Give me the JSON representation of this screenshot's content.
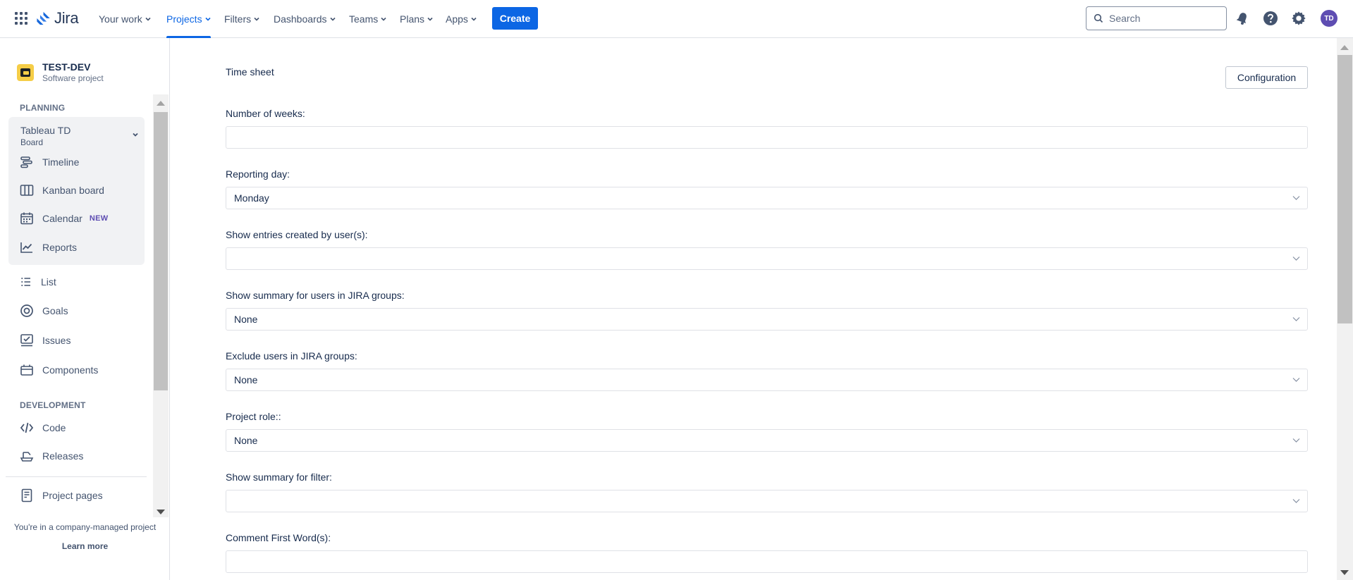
{
  "topnav": {
    "logo_text": "Jira",
    "items": [
      {
        "label": "Your work"
      },
      {
        "label": "Projects"
      },
      {
        "label": "Filters"
      },
      {
        "label": "Dashboards"
      },
      {
        "label": "Teams"
      },
      {
        "label": "Plans"
      },
      {
        "label": "Apps"
      }
    ],
    "create_label": "Create",
    "search_placeholder": "Search",
    "avatar_initials": "TD",
    "accent_color": "#0c66e4"
  },
  "sidebar": {
    "project_name": "TEST-DEV",
    "project_type": "Software project",
    "planning_label": "PLANNING",
    "board_name": "Tableau TD",
    "board_sub": "Board",
    "planning_items": [
      {
        "label": "Timeline",
        "icon": "timeline-icon"
      },
      {
        "label": "Kanban board",
        "icon": "kanban-icon"
      },
      {
        "label": "Calendar",
        "icon": "calendar-icon",
        "badge": "NEW"
      },
      {
        "label": "Reports",
        "icon": "reports-icon"
      }
    ],
    "other_items": [
      {
        "label": "List",
        "icon": "list-icon"
      },
      {
        "label": "Goals",
        "icon": "goals-icon"
      },
      {
        "label": "Issues",
        "icon": "issues-icon"
      },
      {
        "label": "Components",
        "icon": "components-icon"
      }
    ],
    "development_label": "DEVELOPMENT",
    "development_items": [
      {
        "label": "Code",
        "icon": "code-icon"
      },
      {
        "label": "Releases",
        "icon": "releases-icon"
      }
    ],
    "project_pages_label": "Project pages",
    "footer_text": "You're in a company-managed project",
    "learn_more": "Learn more"
  },
  "main": {
    "title": "Time sheet",
    "config_label": "Configuration",
    "fields": [
      {
        "label": "Number of weeks:",
        "type": "input",
        "value": ""
      },
      {
        "label": "Reporting day:",
        "type": "select",
        "value": "Monday"
      },
      {
        "label": "Show entries created by user(s):",
        "type": "select",
        "value": ""
      },
      {
        "label": "Show summary for users in JIRA groups:",
        "type": "select",
        "value": "None"
      },
      {
        "label": "Exclude users in JIRA groups:",
        "type": "select",
        "value": "None"
      },
      {
        "label": "Project role::",
        "type": "select",
        "value": "None"
      },
      {
        "label": "Show summary for filter:",
        "type": "select",
        "value": ""
      },
      {
        "label": "Comment First Word(s):",
        "type": "input",
        "value": ""
      }
    ]
  }
}
